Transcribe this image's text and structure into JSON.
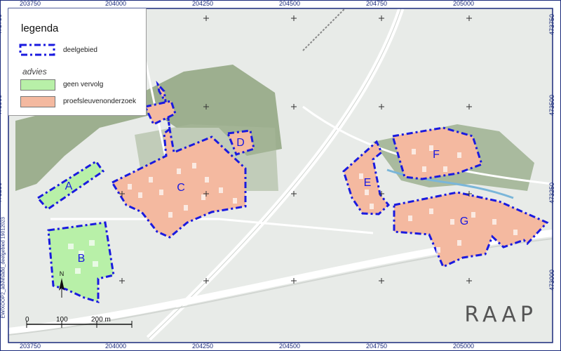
{
  "legend": {
    "title": "legenda",
    "boundary_label": "deelgebied",
    "advice_heading": "advies",
    "items": [
      {
        "label": "geen vervolg",
        "color": "#b8f0a8"
      },
      {
        "label": "proefsleuvenonderzoek",
        "color": "#f4b9a0"
      }
    ]
  },
  "coords": {
    "x": [
      "203750",
      "204000",
      "204250",
      "204500",
      "204750",
      "205000"
    ],
    "y": [
      "473750",
      "473500",
      "473250",
      "473000"
    ]
  },
  "areas": [
    {
      "id": "A",
      "advice": "geen vervolg"
    },
    {
      "id": "B",
      "advice": "geen vervolg"
    },
    {
      "id": "C",
      "advice": "proefsleuvenonderzoek"
    },
    {
      "id": "D",
      "advice": "proefsleuvenonderzoek"
    },
    {
      "id": "E",
      "advice": "proefsleuvenonderzoek"
    },
    {
      "id": "F",
      "advice": "proefsleuvenonderzoek"
    },
    {
      "id": "G",
      "advice": "proefsleuvenonderzoek"
    }
  ],
  "scale": {
    "labels": [
      "0",
      "100",
      "200 m"
    ]
  },
  "north_label": "N",
  "credit": "EW/XOOP2_adviesadd_deelgebied 19012023",
  "logo": {
    "text": "RAAP"
  },
  "colors": {
    "boundary": "#1a1adf",
    "frame": "#1a2a7a",
    "forest": "#7e9a6c"
  }
}
